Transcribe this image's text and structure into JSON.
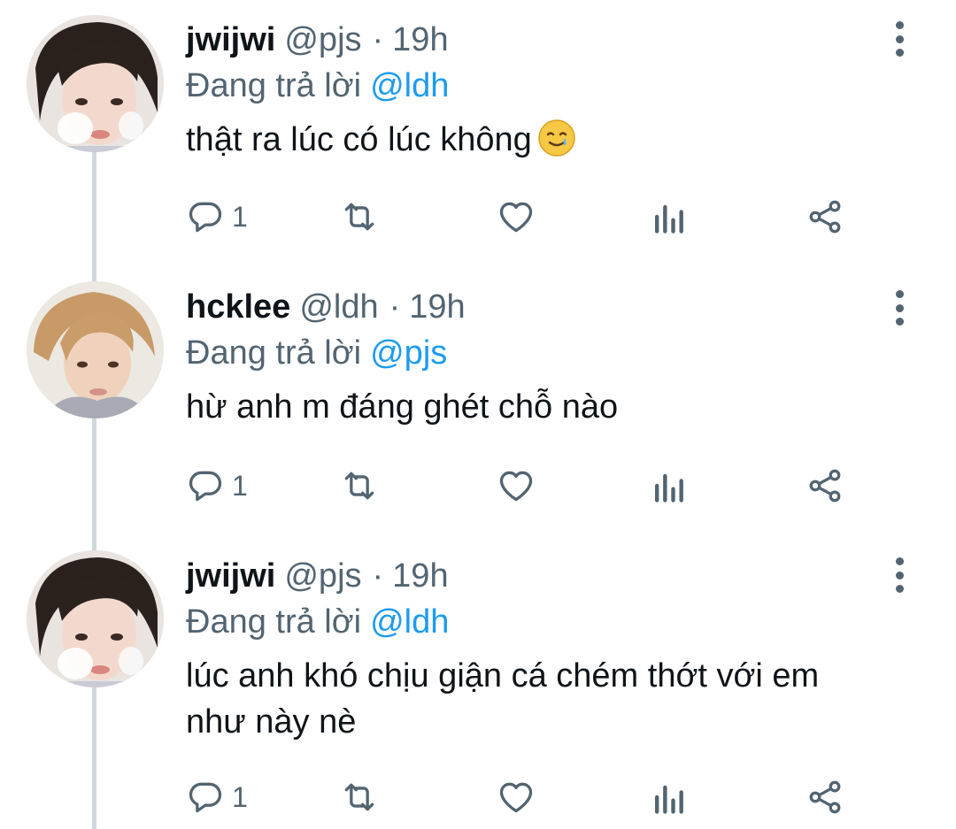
{
  "tweets": [
    {
      "display_name": "jwijwi",
      "handle": "@pjs",
      "separator": "·",
      "time": "19h",
      "replying_label": "Đang trả lời",
      "replying_to": "@ldh",
      "text": "thật ra lúc có lúc không",
      "emoji": "smiling-face-with-tear-icon",
      "reply_count": "1"
    },
    {
      "display_name": "hcklee",
      "handle": "@ldh",
      "separator": "·",
      "time": "19h",
      "replying_label": "Đang trả lời",
      "replying_to": "@pjs",
      "text": "hừ anh m đáng ghét chỗ nào",
      "reply_count": "1"
    },
    {
      "display_name": "jwijwi",
      "handle": "@pjs",
      "separator": "·",
      "time": "19h",
      "replying_label": "Đang trả lời",
      "replying_to": "@ldh",
      "text": "lúc anh khó chịu giận cá chém thớt với em\nnhư này nè",
      "reply_count": "1"
    }
  ],
  "icons": {
    "reply": "reply-icon",
    "retweet": "retweet-icon",
    "like": "heart-icon",
    "views": "views-icon",
    "share": "share-icon",
    "more": "more-vertical-icon"
  },
  "colors": {
    "primary_text": "#0f1419",
    "secondary_text": "#536471",
    "accent": "#1d9bf0",
    "thread_line": "#cfd9de"
  }
}
